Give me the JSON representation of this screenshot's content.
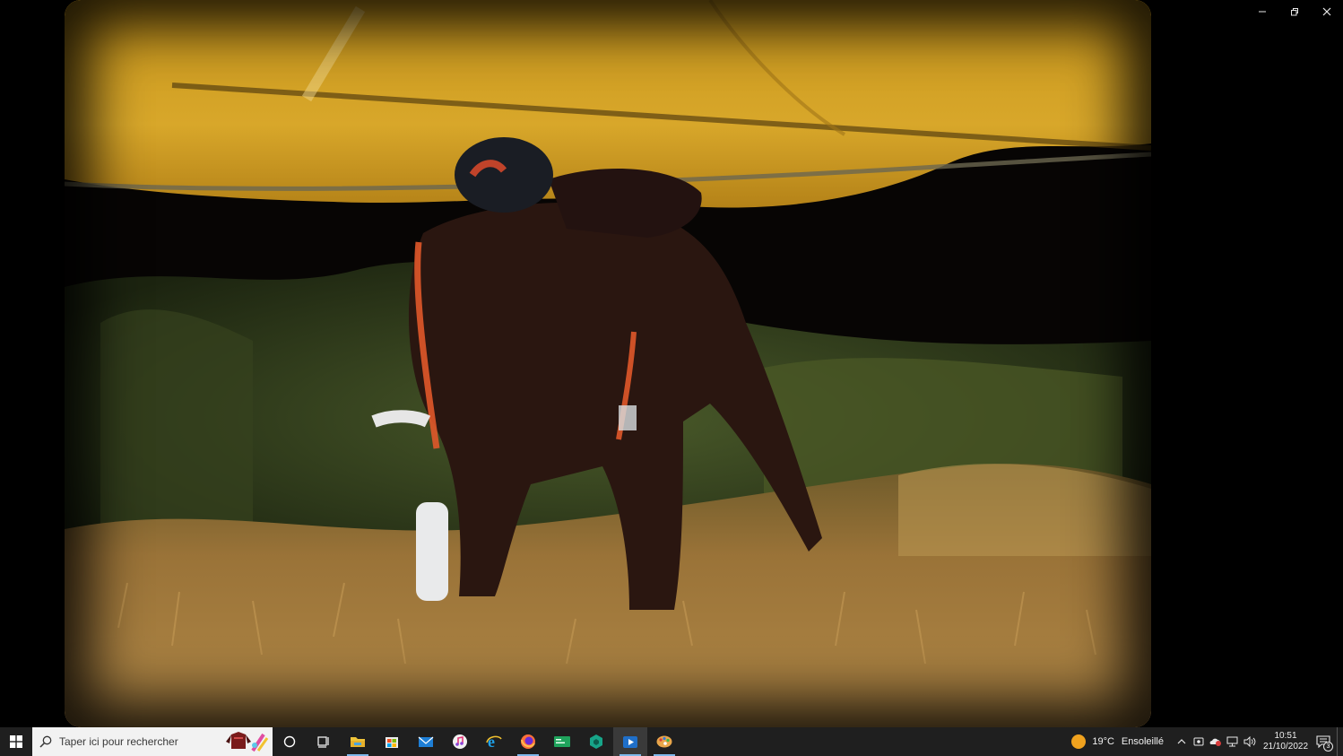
{
  "window": {
    "controls": {
      "minimize_icon": "minimize-icon",
      "restore_icon": "restore-icon",
      "close_icon": "close-icon"
    }
  },
  "photo": {
    "colors": {
      "canopy": "#d6a321",
      "grass": "#b58a45",
      "foliage": "#3c4a22",
      "horse": "#2a1610",
      "harness": "#e0582a"
    }
  },
  "taskbar": {
    "start_icon": "windows-start-icon",
    "search": {
      "icon": "search-icon",
      "placeholder": "Taper ici pour rechercher"
    },
    "pinned": [
      {
        "name": "cortana-icon"
      },
      {
        "name": "task-view-icon"
      },
      {
        "name": "file-explorer-icon"
      },
      {
        "name": "microsoft-store-icon"
      },
      {
        "name": "mail-icon"
      },
      {
        "name": "itunes-icon"
      },
      {
        "name": "internet-explorer-icon"
      },
      {
        "name": "firefox-icon"
      },
      {
        "name": "terminal-app-icon"
      },
      {
        "name": "green-cube-app-icon"
      },
      {
        "name": "media-player-icon"
      },
      {
        "name": "paint-app-icon"
      }
    ],
    "weather": {
      "icon": "sun-icon",
      "temperature": "19°C",
      "condition": "Ensoleillé"
    },
    "tray": {
      "chevron_icon": "chevron-up-icon",
      "meet_icon": "meet-now-icon",
      "cloud_icon": "onedrive-icon",
      "network_icon": "network-icon",
      "volume_icon": "volume-icon"
    },
    "clock": {
      "time": "10:51",
      "date": "21/10/2022"
    },
    "notifications": {
      "icon": "notification-center-icon",
      "count": "3"
    },
    "accent": "#7db8ea",
    "background": "#1f1f1f"
  }
}
